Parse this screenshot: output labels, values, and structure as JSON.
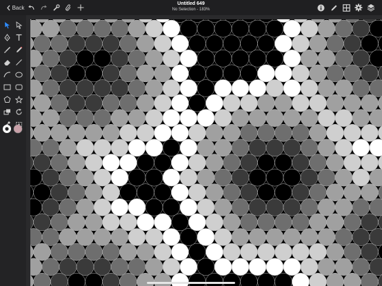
{
  "window": {
    "title": "Untitled 649",
    "subtitle": "No Selection - 183%"
  },
  "toolbar": {
    "back_label": "Back",
    "left_icons": [
      "undo-icon",
      "redo-icon",
      "wrench-icon",
      "paperclip-icon",
      "plus-icon"
    ],
    "right_icons": [
      "info-icon",
      "pencil-icon",
      "grid-icon",
      "gear-icon",
      "layers-icon"
    ]
  },
  "sidebar": {
    "tools": [
      "selection-arrow-icon",
      "direct-selection-arrow-icon",
      "pen-icon",
      "text-icon",
      "brush-icon",
      "pencil-tool-icon",
      "eraser-icon",
      "line-icon",
      "arc-icon",
      "ellipse-icon",
      "rectangle-icon",
      "rounded-rectangle-icon",
      "polygon-icon",
      "star-icon",
      "shape-builder-icon",
      "rotate-icon",
      "eyedropper-icon",
      "transform-icon"
    ],
    "fill_color": "#ffffff",
    "stroke_color": "#c8a0a8"
  },
  "colors": {
    "accent": "#2f8cff",
    "chrome": "#1f1f21",
    "canvas_bg": "#000000"
  }
}
